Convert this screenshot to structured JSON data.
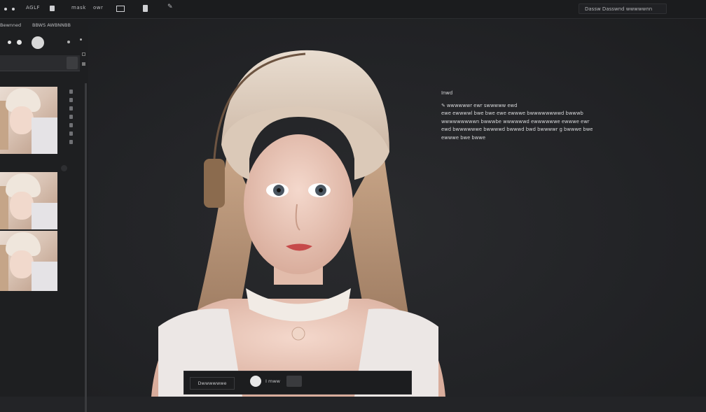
{
  "toolbar": {
    "title": "AGLF",
    "center_label": "mask",
    "center_label2": "owr",
    "search_text": "Dassw Dasswnd wwwwwnn",
    "icons": [
      "dot-icon",
      "layer-icon",
      "image-icon",
      "document-icon",
      "pin-icon"
    ]
  },
  "sidebar": {
    "tab1": "Bewnned",
    "tab2": "BBWS AWBNNBB",
    "thumbnails": [
      "portrait-thumb-1",
      "portrait-thumb-2",
      "portrait-thumb-3"
    ]
  },
  "info": {
    "heading": "Inwd",
    "lines": [
      "✎ wwwwwwr ewr swwwww ewd",
      "ewe ewwwwl bwe bwe ewe ewwwe bwwwwwwwwd bwwwb",
      "wwwwwwwwwn bwwwbe wwwwwwd ewwwwwwe ewwwe ewr",
      "ewd bwwwwwwe bwwwwd bwwwd bwd bwwwwr g bwwwe bwe",
      "ewwwe bwe bwwe"
    ]
  },
  "bottom": {
    "label": "Dwwwwwwe",
    "text": "I  mww"
  },
  "colors": {
    "background": "#232427",
    "panel": "#1e1f21",
    "topbar": "#1b1c1e",
    "text": "#d7d8da"
  }
}
